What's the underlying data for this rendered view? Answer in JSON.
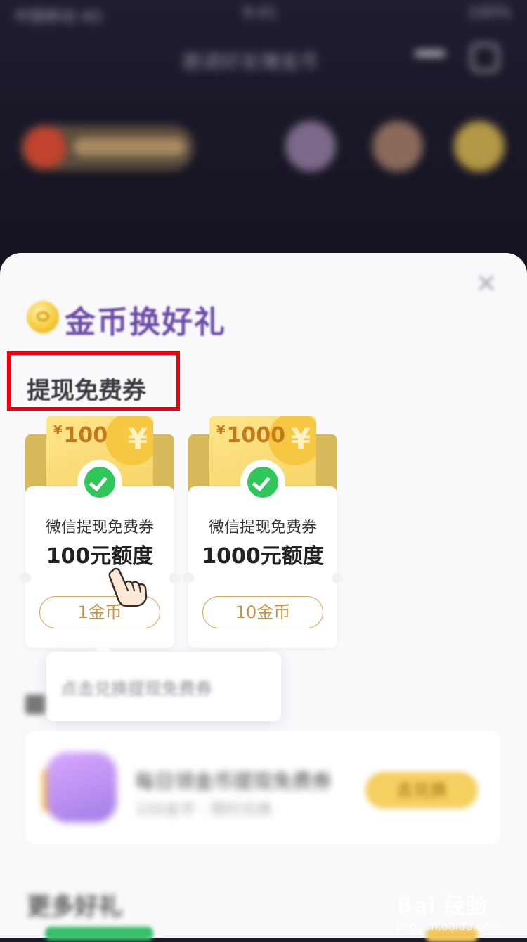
{
  "status_bar": {
    "carrier": "中国移动 4G",
    "time": "9:41",
    "battery": "100%"
  },
  "background_header": {
    "title": "邀请好友赚金币"
  },
  "sheet": {
    "title": "金币换好礼",
    "section_title": "提现免费券",
    "coupons": [
      {
        "currency_symbol": "¥",
        "amount": "100",
        "label": "微信提现免费券",
        "quota": "100元额度",
        "price": "1金币"
      },
      {
        "currency_symbol": "¥",
        "amount": "1000",
        "label": "微信提现免费券",
        "quota": "1000元额度",
        "price": "10金币"
      }
    ],
    "coupon_yen_mark": "¥",
    "tooltip": "点击兑换提现免费券",
    "list_item": {
      "title": "每日领金币提现免费券",
      "subtitle": "100金币 · 限时兑换",
      "button": "去兑换"
    },
    "more_title": "更多好礼"
  },
  "watermark": {
    "main": "Bai 经验",
    "sub": "jingyan.baidu.com"
  },
  "colors": {
    "title_purple": "#6b4aa6",
    "highlight_red": "#f0000a",
    "gold": "#f7d364",
    "wechat_green": "#2fc75a",
    "price_border": "#d9a85a"
  },
  "icons": [
    "coin-icon",
    "close-icon",
    "wechat-icon",
    "hand-pointer-icon",
    "yen-icon"
  ]
}
